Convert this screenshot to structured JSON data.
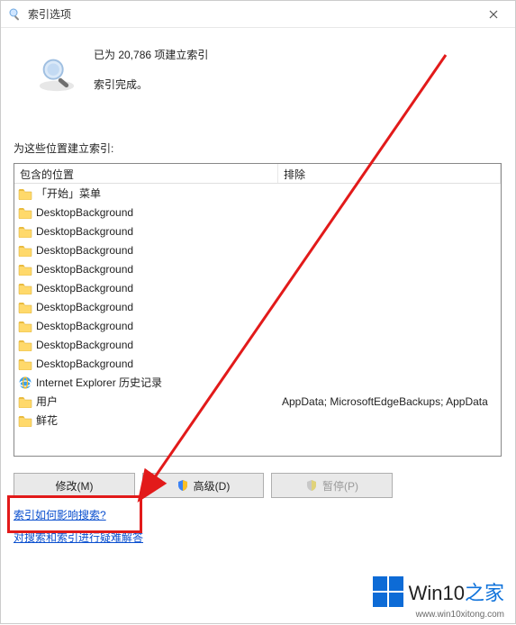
{
  "window": {
    "title": "索引选项"
  },
  "summary": {
    "line1": "已为 20,786 项建立索引",
    "line2": "索引完成。"
  },
  "locations_label": "为这些位置建立索引:",
  "columns": {
    "included": "包含的位置",
    "excluded": "排除"
  },
  "rows": [
    {
      "icon": "folder",
      "name": "「开始」菜单",
      "excl": ""
    },
    {
      "icon": "folder",
      "name": "DesktopBackground",
      "excl": ""
    },
    {
      "icon": "folder",
      "name": "DesktopBackground",
      "excl": ""
    },
    {
      "icon": "folder",
      "name": "DesktopBackground",
      "excl": ""
    },
    {
      "icon": "folder",
      "name": "DesktopBackground",
      "excl": ""
    },
    {
      "icon": "folder",
      "name": "DesktopBackground",
      "excl": ""
    },
    {
      "icon": "folder",
      "name": "DesktopBackground",
      "excl": ""
    },
    {
      "icon": "folder",
      "name": "DesktopBackground",
      "excl": ""
    },
    {
      "icon": "folder",
      "name": "DesktopBackground",
      "excl": ""
    },
    {
      "icon": "folder",
      "name": "DesktopBackground",
      "excl": ""
    },
    {
      "icon": "ie",
      "name": "Internet Explorer 历史记录",
      "excl": ""
    },
    {
      "icon": "folder",
      "name": "用户",
      "excl": "AppData; MicrosoftEdgeBackups; AppData"
    },
    {
      "icon": "folder",
      "name": "鲜花",
      "excl": ""
    }
  ],
  "buttons": {
    "modify": "修改(M)",
    "advanced": "高级(D)",
    "pause": "暂停(P)"
  },
  "links": {
    "how": "索引如何影响搜索?",
    "trouble": "对搜索和索引进行疑难解答"
  },
  "branding": {
    "name_part1": "Win10",
    "name_part2": "之家",
    "url": "www.win10xitong.com"
  }
}
